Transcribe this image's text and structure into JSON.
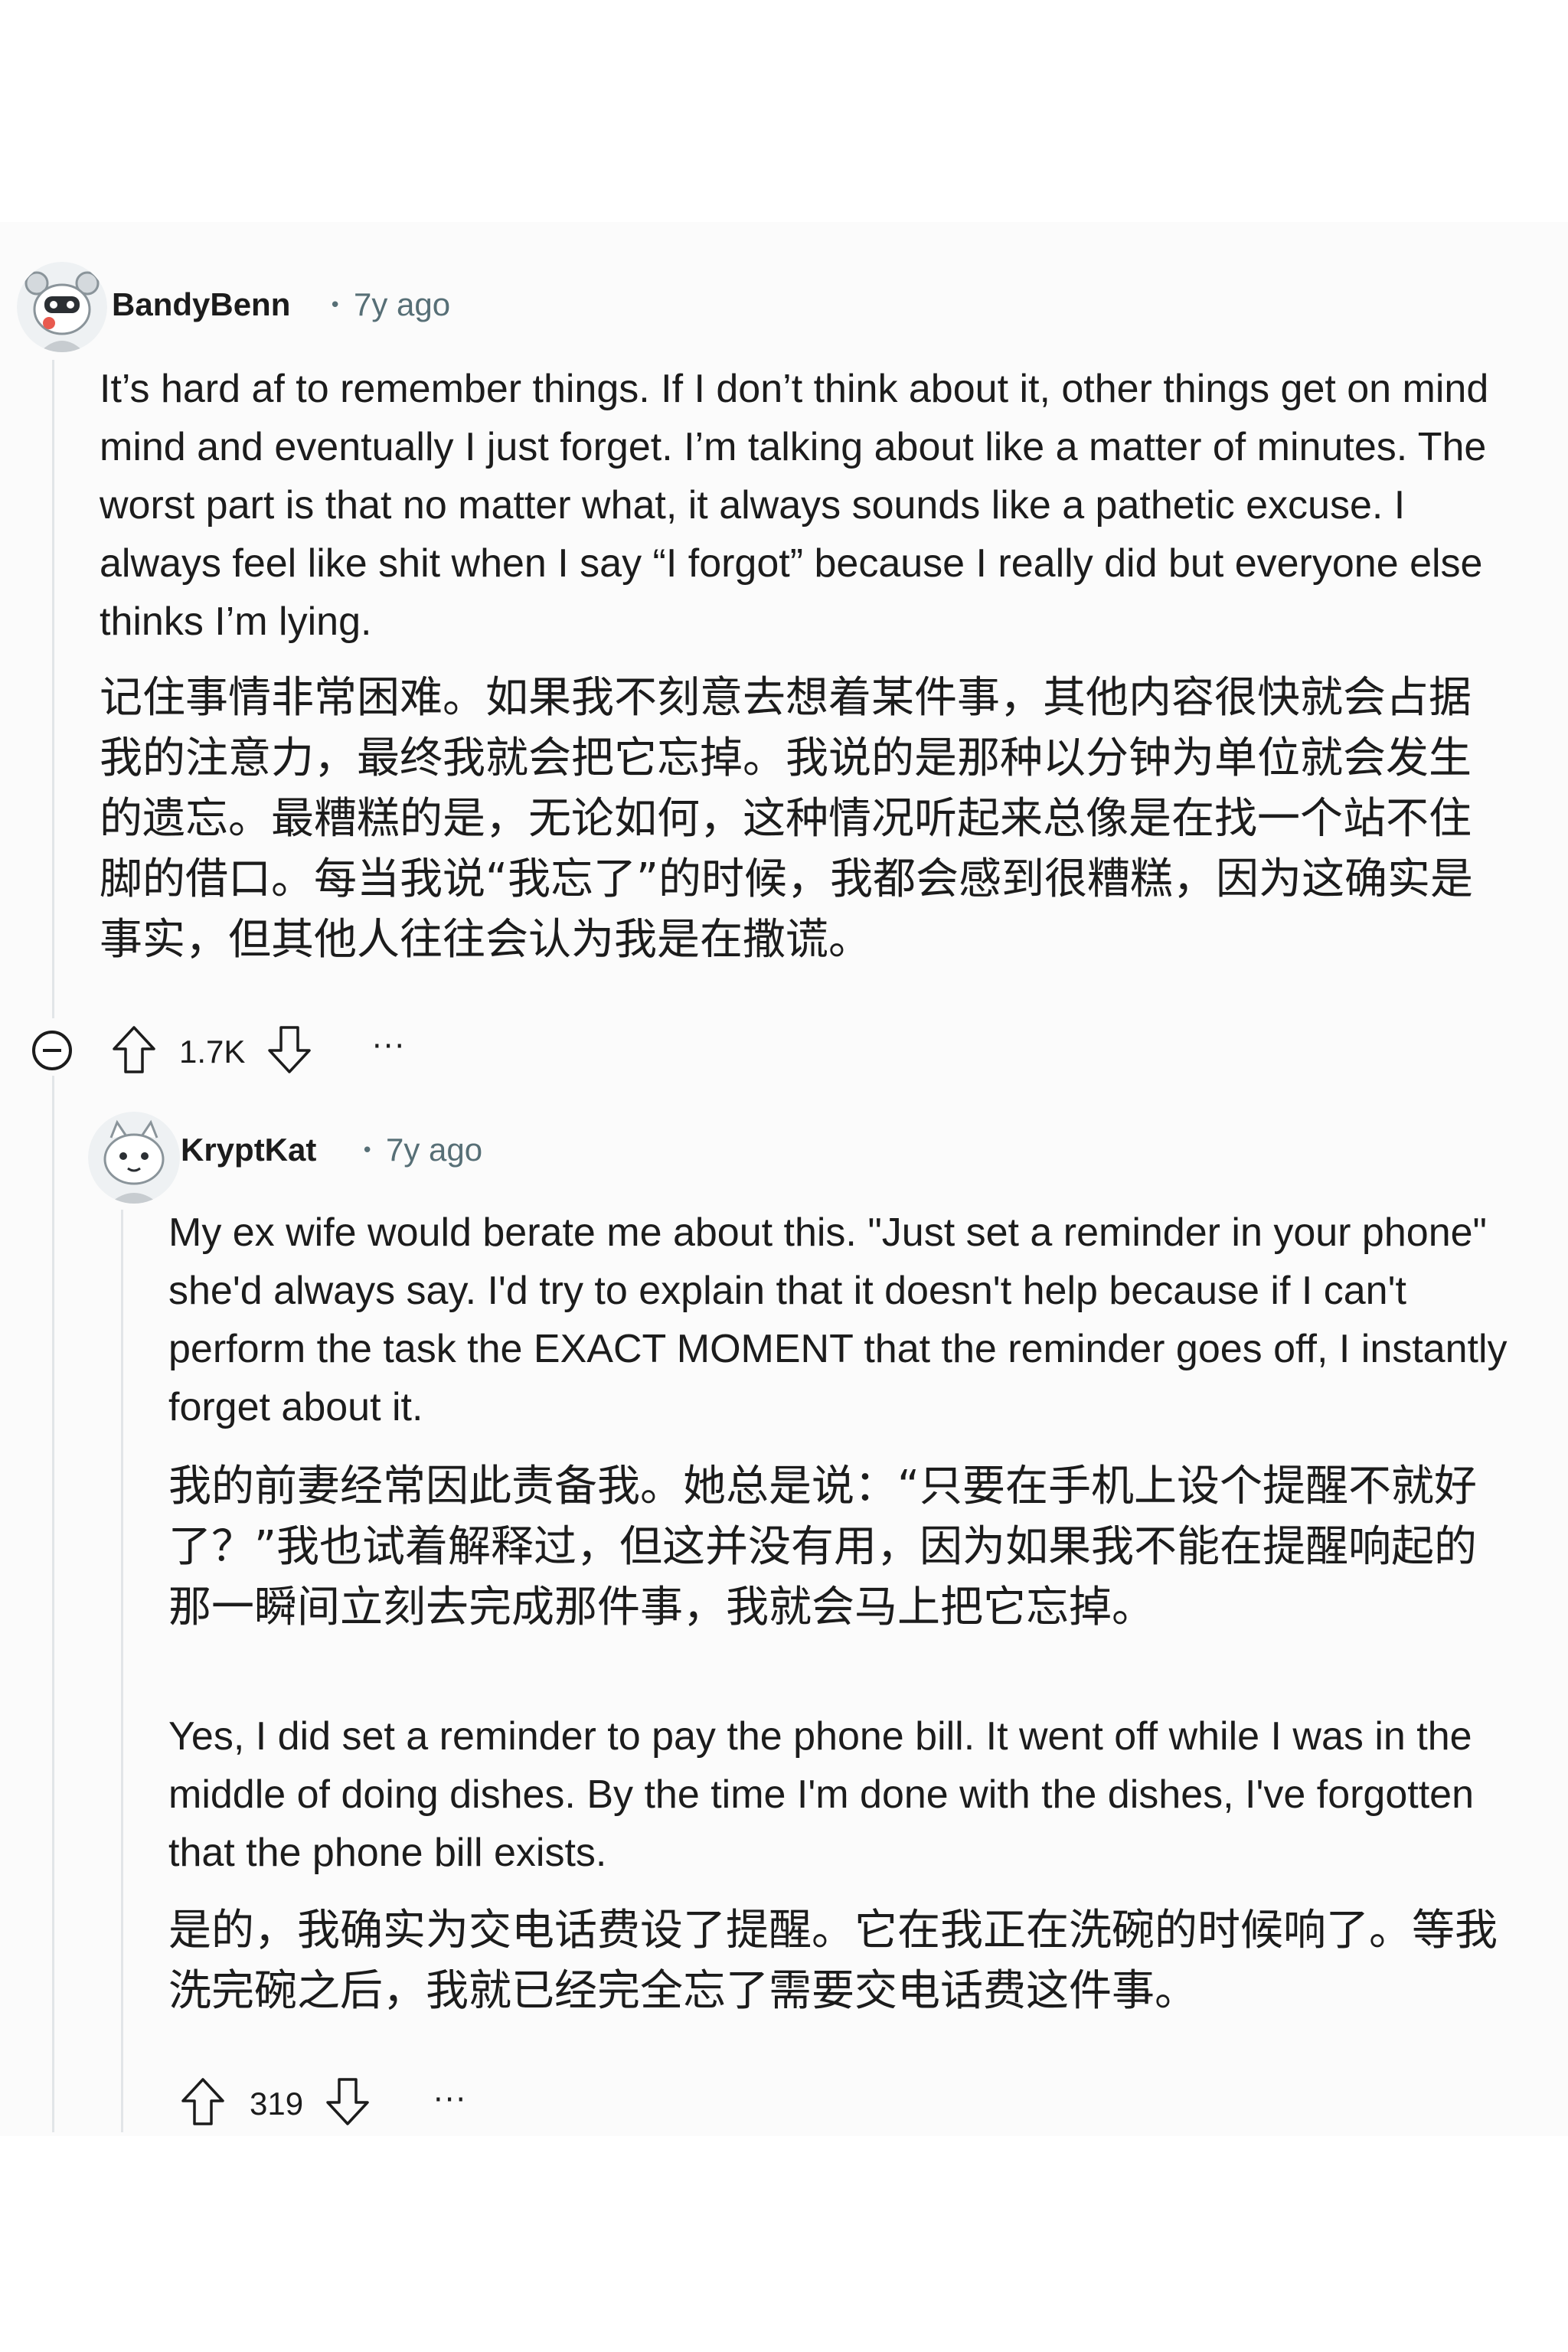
{
  "comments": [
    {
      "username": "BandyBenn",
      "time": "7y ago",
      "avatar": "robot-snoo-avatar",
      "body_en": "It’s hard af to remember things. If I don’t think about it, other things get on mind mind and eventually I just forget. I’m talking about like a matter of minutes. The worst part is that no matter what, it always sounds like a pathetic excuse. I always feel like shit when I say “I forgot” because I really did but everyone else thinks I’m lying.",
      "body_zh": "记住事情非常困难。如果我不刻意去想着某件事，其他内容很快就会占据我的注意力，最终我就会把它忘掉。我说的是那种以分钟为单位就会发生的遗忘。最糟糕的是，无论如何，这种情况听起来总像是在找一个站不住脚的借口。每当我说“我忘了”的时候，我都会感到很糟糕，因为这确实是事实，但其他人往往会认为我是在撒谎。",
      "votes": "1.7K"
    },
    {
      "username": "KryptKat",
      "time": "7y ago",
      "avatar": "cat-snoo-avatar",
      "body_en": "My ex wife would berate me about this. \"Just set a reminder in your phone\" she'd always say. I'd try to explain that it doesn't help because if I can't perform the task the EXACT MOMENT that the reminder goes off, I instantly forget about it.",
      "body_zh": "我的前妻经常因此责备我。她总是说：“只要在手机上设个提醒不就好了？”我也试着解释过，但这并没有用，因为如果我不能在提醒响起的那一瞬间立刻去完成那件事，我就会马上把它忘掉。",
      "body_en_2": "Yes, I did set a reminder to pay the phone bill. It went off while I was in the middle of doing dishes. By the time I'm done with the dishes, I've forgotten that the phone bill exists.",
      "body_zh_2": "是的，我确实为交电话费设了提醒。它在我正在洗碗的时候响了。等我洗完碗之后，我就已经完全忘了需要交电话费这件事。",
      "votes": "319"
    }
  ],
  "icons": {
    "collapse": "collapse-minus-icon",
    "upvote": "upvote-arrow-icon",
    "downvote": "downvote-arrow-icon",
    "more": "more-options-icon"
  },
  "more_label": "···",
  "colors": {
    "text": "#1c1c1c",
    "meta": "#576f76",
    "thread_line": "#e2e5e8"
  }
}
